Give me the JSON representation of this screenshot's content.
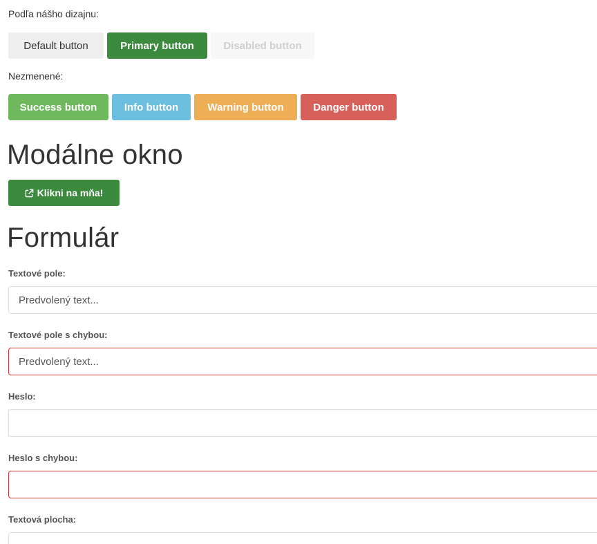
{
  "buttons_section": {
    "our_design_label": "Podľa nášho dizajnu:",
    "default_label": "Default button",
    "primary_label": "Primary button",
    "disabled_label": "Disabled button",
    "unchanged_label": "Nezmenené:",
    "success_label": "Success button",
    "info_label": "Info button",
    "warning_label": "Warning button",
    "danger_label": "Danger button"
  },
  "modal_section": {
    "heading": "Modálne okno",
    "button_label": "Klikni na mňa!",
    "button_icon": "external-link-icon"
  },
  "form_section": {
    "heading": "Formulár",
    "text_field_label": "Textové pole:",
    "text_field_placeholder": "Predvolený text...",
    "text_field_error_label": "Textové pole s chybou:",
    "text_field_error_placeholder": "Predvolený text...",
    "password_label": "Heslo:",
    "password_error_label": "Heslo s chybou:",
    "textarea_label": "Textová plocha:"
  },
  "colors": {
    "primary": "#3b8a3e",
    "success": "#6fb85d",
    "info": "#6cbfdf",
    "warning": "#eeae55",
    "danger": "#d7605a",
    "error_border": "#c9302c"
  }
}
